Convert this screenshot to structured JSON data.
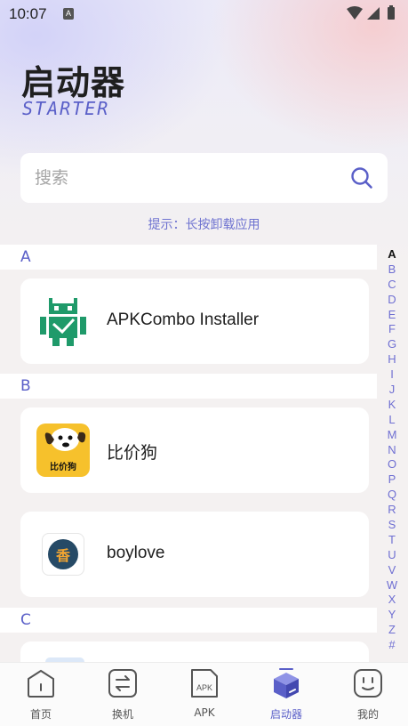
{
  "status": {
    "time": "10:07",
    "notif_glyph": "A"
  },
  "header": {
    "title": "启动器",
    "subtitle": "STARTER"
  },
  "search": {
    "placeholder": "搜索"
  },
  "hint": "提示：长按卸载应用",
  "sections": [
    {
      "letter": "A",
      "apps": [
        {
          "name": "APKCombo Installer",
          "icon": "android-robot-icon"
        }
      ]
    },
    {
      "letter": "B",
      "apps": [
        {
          "name": "比价狗",
          "icon": "dog-logo-icon",
          "logo_text": "比价狗"
        },
        {
          "name": "boylove",
          "icon": "boylove-icon",
          "logo_text": "香"
        }
      ]
    },
    {
      "letter": "C",
      "apps": []
    }
  ],
  "alphabet": [
    "A",
    "B",
    "C",
    "D",
    "E",
    "F",
    "G",
    "H",
    "I",
    "J",
    "K",
    "L",
    "M",
    "N",
    "O",
    "P",
    "Q",
    "R",
    "S",
    "T",
    "U",
    "V",
    "W",
    "X",
    "Y",
    "Z",
    "#"
  ],
  "nav": [
    {
      "label": "首页",
      "icon": "home-icon"
    },
    {
      "label": "换机",
      "icon": "transfer-icon"
    },
    {
      "label": "APK",
      "icon": "apk-file-icon",
      "icon_text": "APK"
    },
    {
      "label": "启动器",
      "icon": "launcher-cube-icon",
      "active": true
    },
    {
      "label": "我的",
      "icon": "profile-face-icon"
    }
  ],
  "colors": {
    "accent": "#5a5fc8",
    "android_green": "#1f9a6a",
    "dog_yellow": "#f6c12c"
  }
}
